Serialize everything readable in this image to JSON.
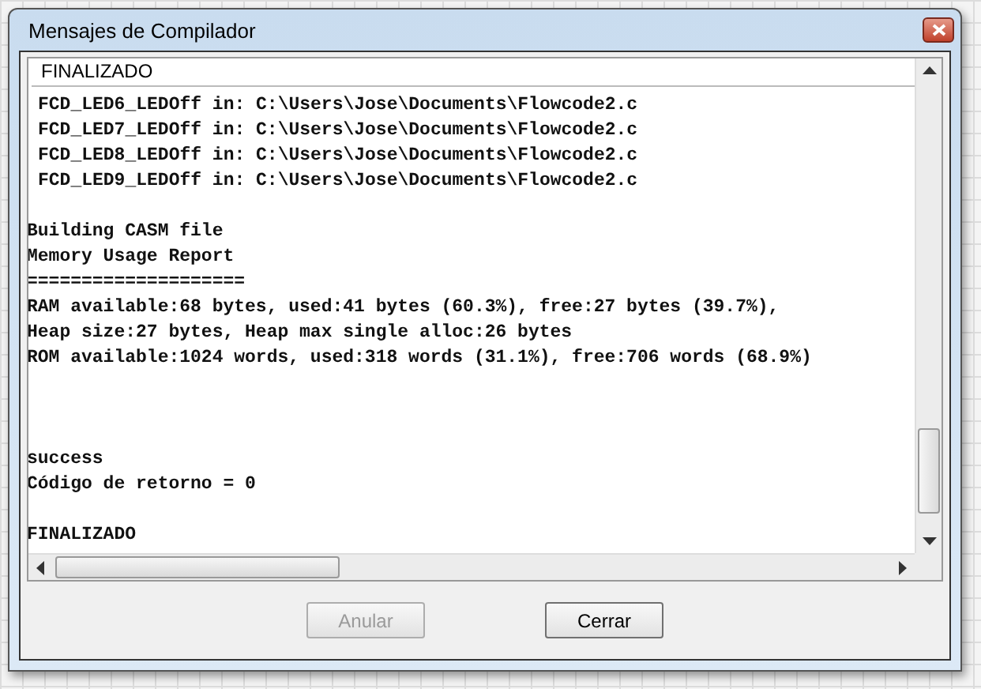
{
  "window": {
    "title": "Mensajes de Compilador"
  },
  "output": {
    "header": "FINALIZADO",
    "lines": [
      {
        "kind": "entry",
        "text": "FCD_LED6_LEDOff in: C:\\Users\\Jose\\Documents\\Flowcode2.c"
      },
      {
        "kind": "entry",
        "text": "FCD_LED7_LEDOff in: C:\\Users\\Jose\\Documents\\Flowcode2.c"
      },
      {
        "kind": "entry",
        "text": "FCD_LED8_LEDOff in: C:\\Users\\Jose\\Documents\\Flowcode2.c"
      },
      {
        "kind": "entry",
        "text": "FCD_LED9_LEDOff in: C:\\Users\\Jose\\Documents\\Flowcode2.c"
      },
      {
        "kind": "blank"
      },
      {
        "kind": "plain",
        "text": "Building CASM file"
      },
      {
        "kind": "plain",
        "text": "Memory Usage Report"
      },
      {
        "kind": "plain",
        "text": "===================="
      },
      {
        "kind": "plain",
        "text": "RAM available:68 bytes, used:41 bytes (60.3%), free:27 bytes (39.7%),"
      },
      {
        "kind": "plain",
        "text": "Heap size:27 bytes, Heap max single alloc:26 bytes"
      },
      {
        "kind": "plain",
        "text": "ROM available:1024 words, used:318 words (31.1%), free:706 words (68.9%)"
      },
      {
        "kind": "blank"
      },
      {
        "kind": "blank"
      },
      {
        "kind": "blank"
      },
      {
        "kind": "plain",
        "text": "success"
      },
      {
        "kind": "plain",
        "text": "Código de retorno = 0"
      },
      {
        "kind": "blank"
      },
      {
        "kind": "plain",
        "text": "FINALIZADO"
      }
    ]
  },
  "buttons": [
    {
      "label": "Anular",
      "disabled": true
    },
    {
      "label": "Cerrar",
      "disabled": false
    }
  ]
}
